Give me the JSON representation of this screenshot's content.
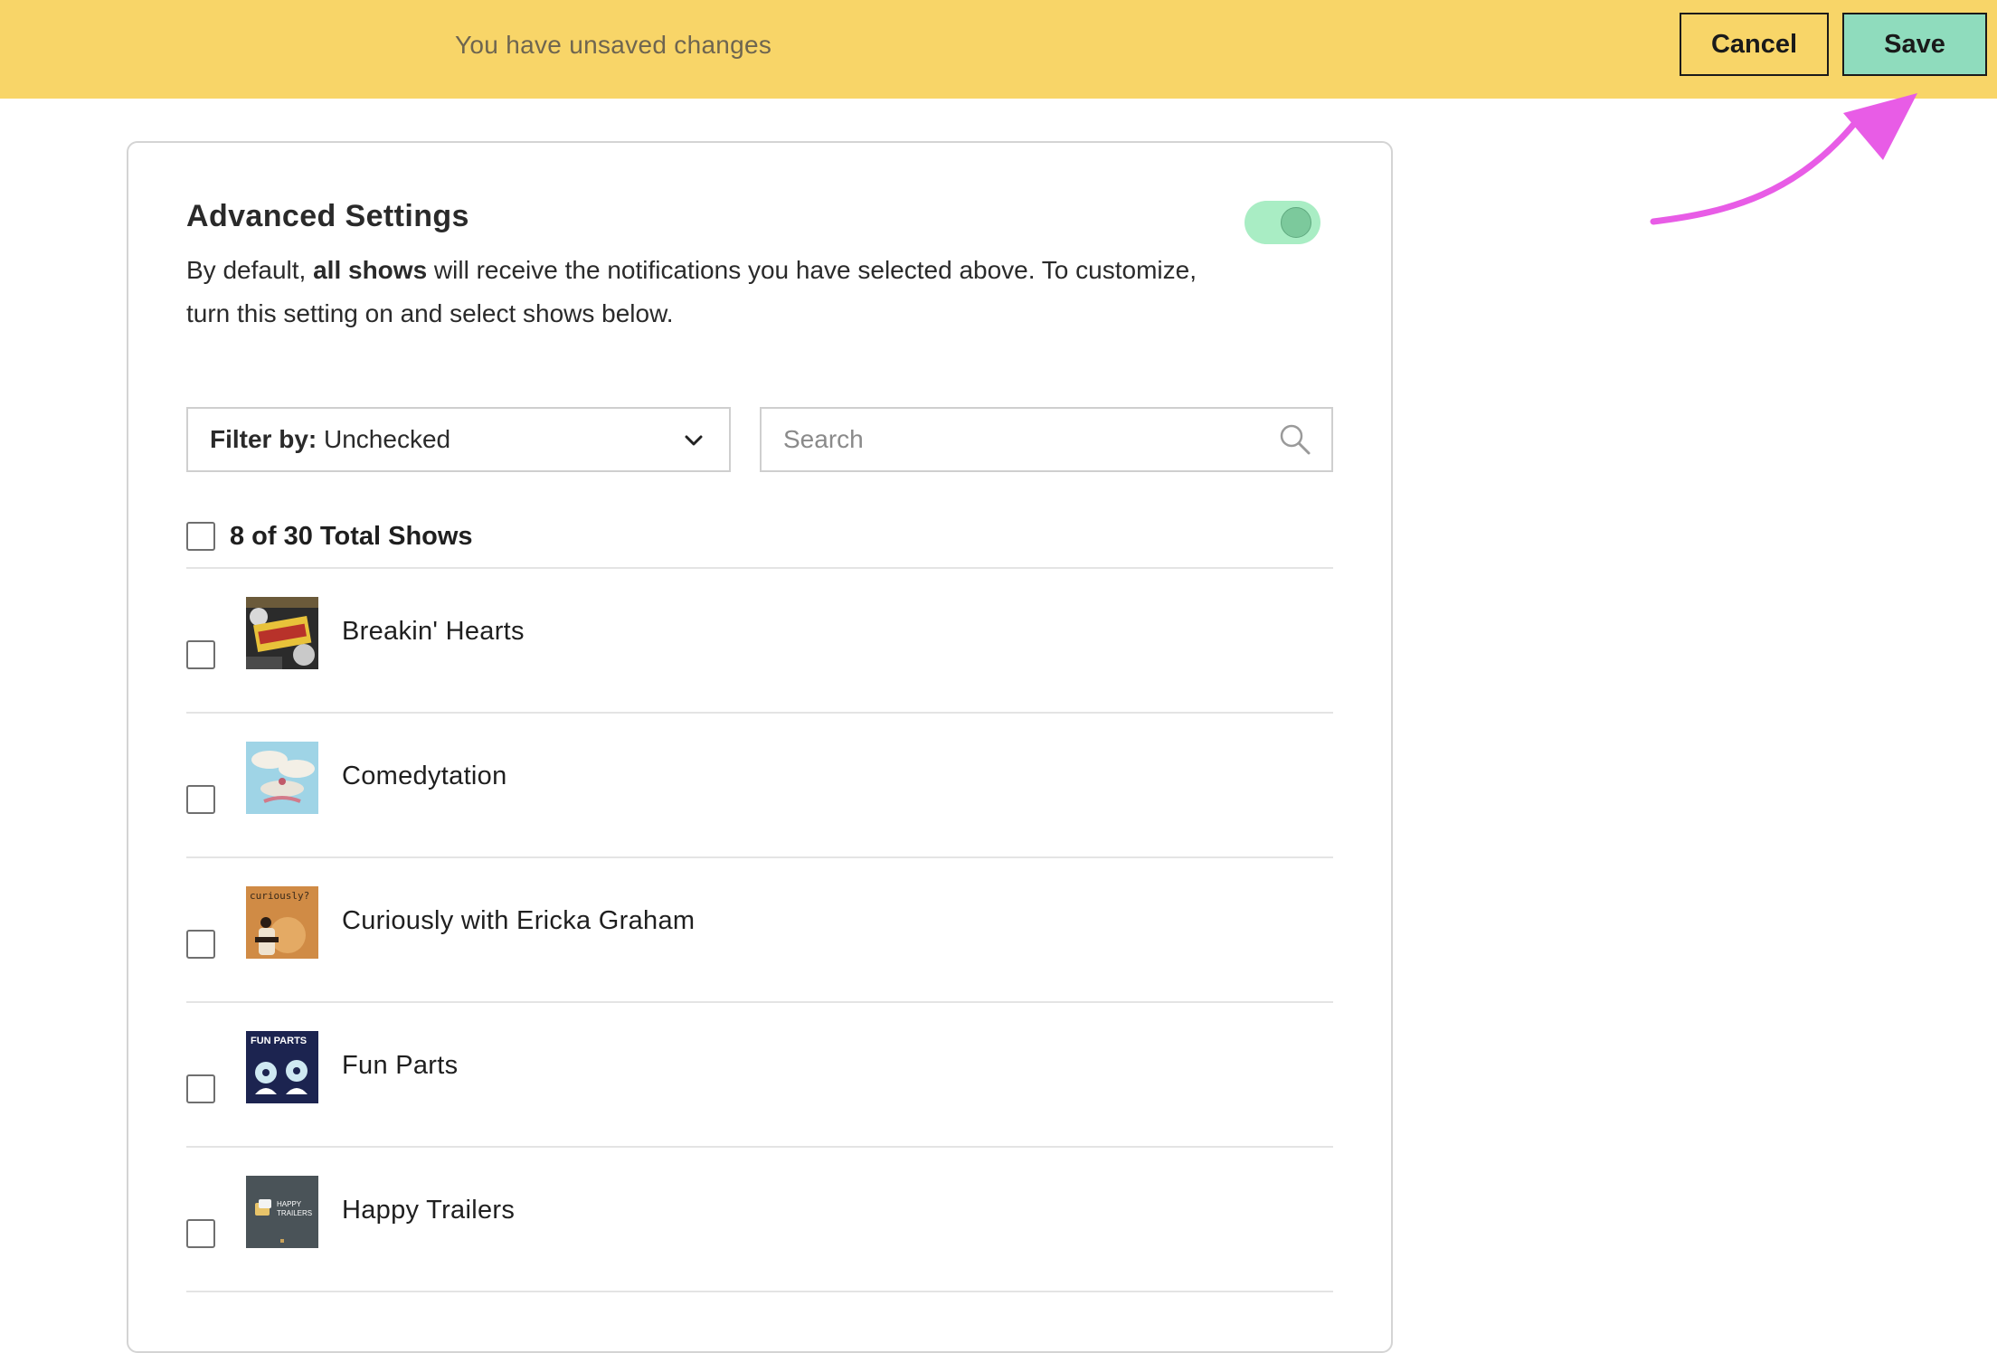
{
  "topbar": {
    "message": "You have unsaved changes",
    "cancel_label": "Cancel",
    "save_label": "Save",
    "background_color": "#f8d568",
    "save_color": "#8fdcbd"
  },
  "advanced": {
    "title": "Advanced Settings",
    "description_prefix": "By default, ",
    "description_bold": "all shows",
    "description_suffix": " will receive the notifications you have selected above. To customize, turn this setting on and select shows below.",
    "toggle_on": true
  },
  "filter": {
    "label": "Filter by:",
    "value": "Unchecked"
  },
  "search": {
    "placeholder": "Search",
    "value": ""
  },
  "total": {
    "label": "8 of 30 Total Shows",
    "checked": false
  },
  "shows": [
    {
      "name": "Breakin' Hearts",
      "checked": false,
      "thumb_icon": "breakin-hearts-artwork"
    },
    {
      "name": "Comedytation",
      "checked": false,
      "thumb_icon": "comedytation-artwork"
    },
    {
      "name": "Curiously with Ericka Graham",
      "checked": false,
      "thumb_icon": "curiously-artwork"
    },
    {
      "name": "Fun Parts",
      "checked": false,
      "thumb_icon": "fun-parts-artwork"
    },
    {
      "name": "Happy Trailers",
      "checked": false,
      "thumb_icon": "happy-trailers-artwork"
    }
  ],
  "thumb_text": {
    "curiously": "curiously?",
    "fun_parts": "FUN PARTS",
    "happy_trailers_1": "HAPPY",
    "happy_trailers_2": "TRAILERS"
  },
  "annotation_arrow_color": "#e85ce6"
}
